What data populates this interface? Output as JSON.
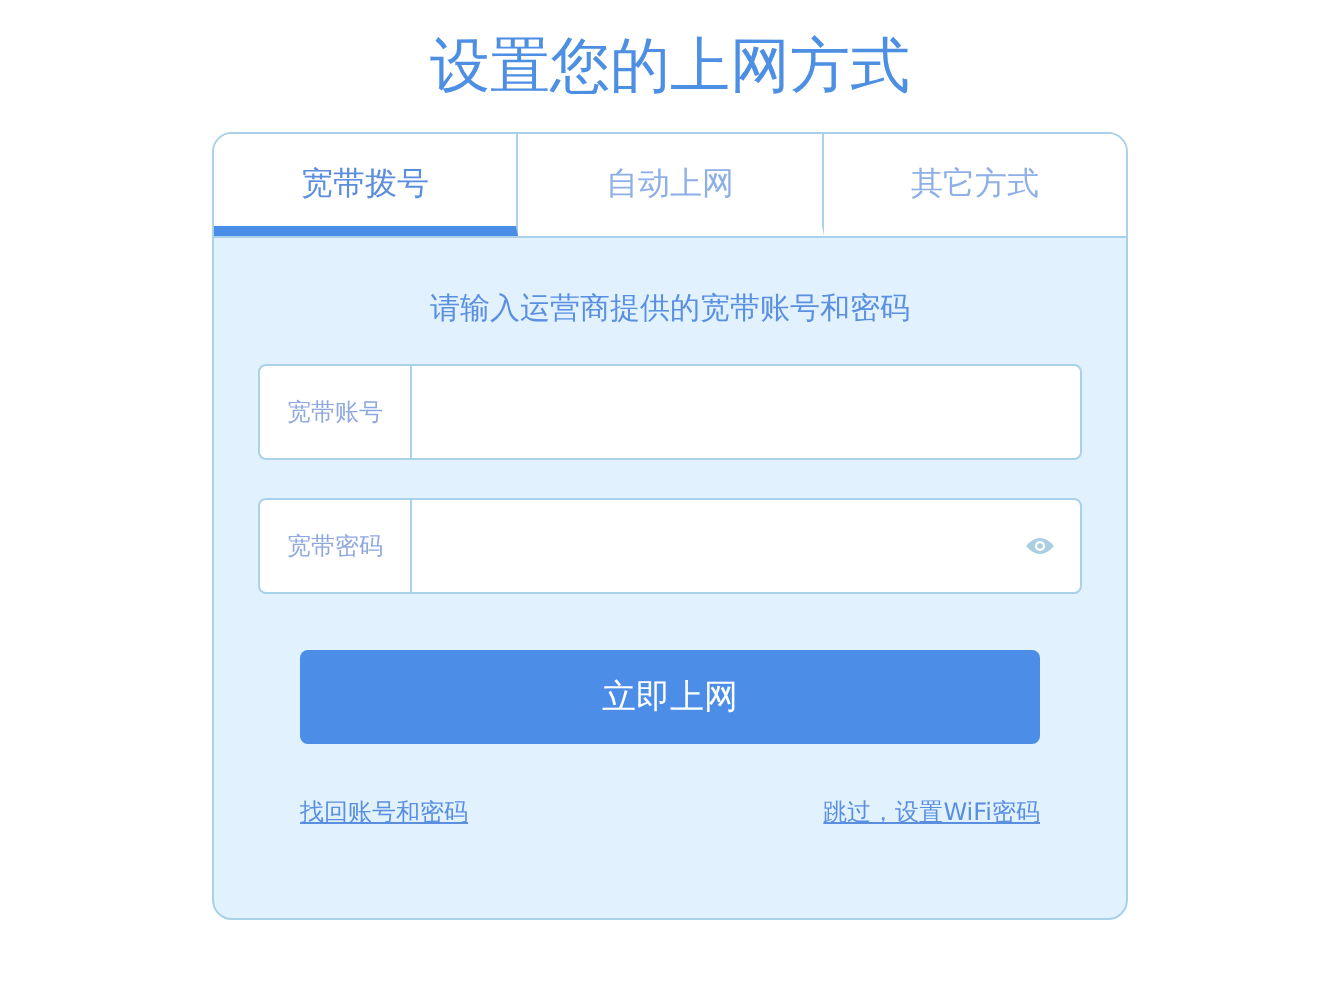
{
  "title": "设置您的上网方式",
  "tabs": [
    {
      "label": "宽带拨号",
      "selected": true
    },
    {
      "label": "自动上网",
      "selected": false
    },
    {
      "label": "其它方式",
      "selected": false
    }
  ],
  "prompt": "请输入运营商提供的宽带账号和密码",
  "fields": [
    {
      "label": "宽带账号",
      "kind": "text"
    },
    {
      "label": "宽带密码",
      "kind": "password"
    }
  ],
  "submit_button": "立即上网",
  "links": [
    "找回账号和密码",
    "跳过，设置WiFi密码"
  ]
}
